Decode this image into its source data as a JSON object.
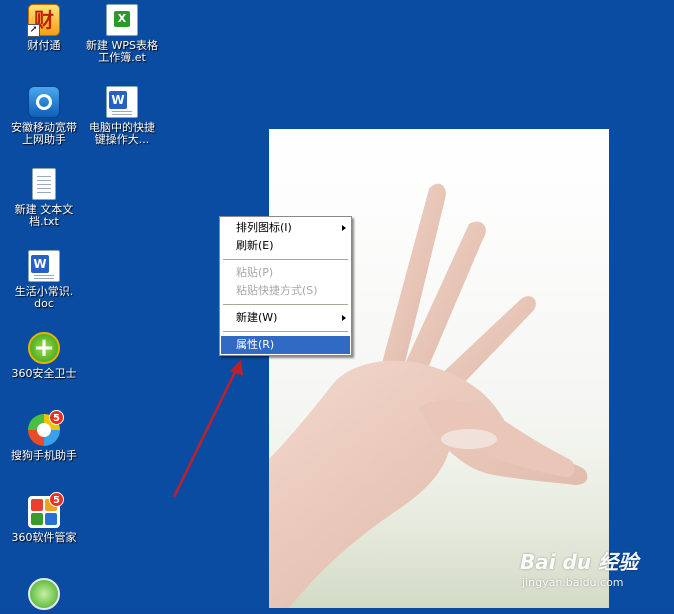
{
  "desktop_icons": [
    {
      "label": "财付通",
      "glyph": "财"
    },
    {
      "label": "新建 WPS表格\n工作簿.et",
      "glyph": "X"
    },
    {
      "label": "安徽移动宽带\n上网助手"
    },
    {
      "label": "电脑中的快捷\n键操作大...",
      "glyph": "W"
    },
    {
      "label": "新建 文本文\n档.txt"
    },
    {
      "label": "生活小常识.\ndoc",
      "glyph": "W"
    },
    {
      "label": "360安全卫士"
    },
    {
      "label": "搜狗手机助手",
      "badge": "5"
    },
    {
      "label": "360软件管家",
      "badge": "5"
    },
    {
      "label": ""
    }
  ],
  "context_menu": {
    "items": [
      {
        "label": "排列图标(I)",
        "submenu": true,
        "disabled": false
      },
      {
        "label": "刷新(E)",
        "disabled": false
      },
      {
        "label": "粘贴(P)",
        "disabled": true
      },
      {
        "label": "粘贴快捷方式(S)",
        "disabled": true
      },
      {
        "label": "新建(W)",
        "submenu": true,
        "disabled": false
      },
      {
        "label": "属性(R)",
        "disabled": false,
        "highlighted": true
      }
    ]
  },
  "watermark": {
    "brand": "Bai du 经验",
    "site": "jingyan.baidu.com"
  },
  "colors": {
    "desktop": "#0b4ca3",
    "menu_highlight": "#316ac5",
    "arrow": "#c0202a"
  }
}
